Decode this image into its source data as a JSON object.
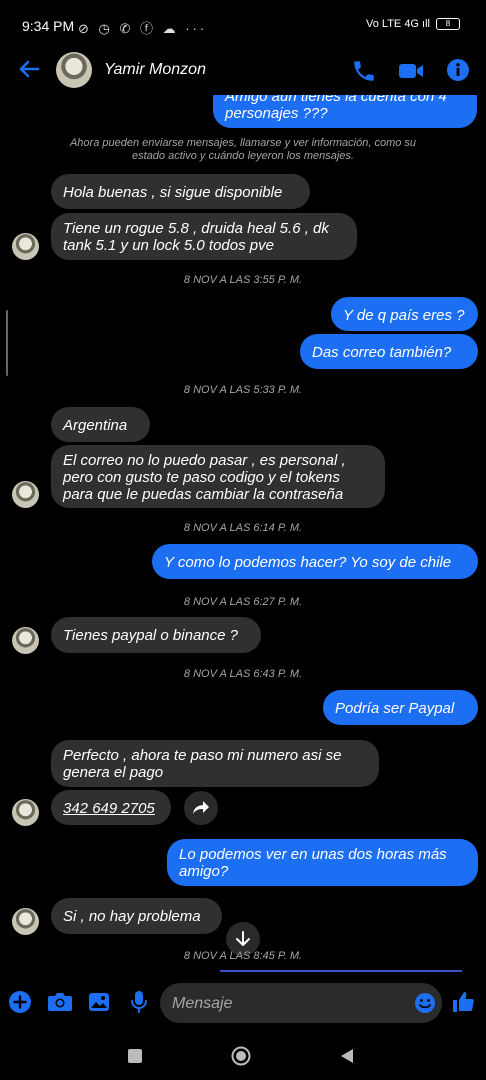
{
  "status_bar": {
    "time": "9:34 PM",
    "icons": "⊘ ◷ ✆ ⓕ ☁ ···",
    "signal": "Vo LTE 4G ıll",
    "battery": "8"
  },
  "header": {
    "contact_name": "Yamir Monzon"
  },
  "conversation": {
    "top_partial": "Amigo aun tienes la cuenta con 4 personajes ???",
    "system_notice": "Ahora pueden enviarse mensajes, llamarse y ver información, como su estado activo y cuándo leyeron los mensajes.",
    "messages": {
      "m1": "Hola buenas , si sigue disponible",
      "m2": "Tiene un rogue 5.8 , druida heal 5.6 , dk tank 5.1 y un lock 5.0 todos pve",
      "t1": "8 NOV A LAS 3:55 P. M.",
      "m3": "Y de q país eres ?",
      "m4": "Das correo también?",
      "t2": "8 NOV A LAS 5:33 P. M.",
      "m5": "Argentina",
      "m6": "El correo no lo puedo pasar ,  es personal , pero con gusto te paso codigo y  el tokens para que le puedas cambiar la contraseña",
      "t3": "8 NOV A LAS 6:14 P. M.",
      "m7": "Y como lo podemos hacer? Yo soy de chile",
      "t4": "8 NOV A LAS 6:27 P. M.",
      "m8": "Tienes paypal o binance ?",
      "t5": "8 NOV A LAS 6:43 P. M.",
      "m9": "Podría ser Paypal",
      "m10": "Perfecto ,  ahora te paso mi numero asi se genera el pago",
      "m11": "342 649 2705",
      "m12": "Lo podemos ver en unas dos horas más amigo?",
      "m13": "Si , no hay problema",
      "t6": "8 NOV A LAS 8:45 P. M."
    }
  },
  "composer": {
    "placeholder": "Mensaje"
  },
  "colors": {
    "accent": "#1c6ef2",
    "incoming_bubble": "#303030",
    "background": "#000000"
  }
}
